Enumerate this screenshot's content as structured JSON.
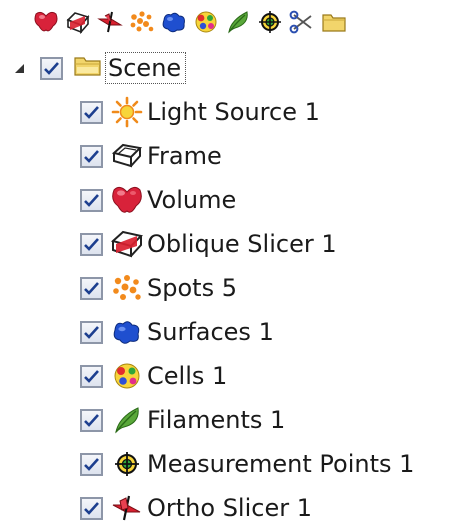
{
  "toolbar": {
    "buttons": [
      {
        "name": "volume",
        "icon": "volume-icon"
      },
      {
        "name": "oblique-slicer",
        "icon": "oblique-slicer-icon"
      },
      {
        "name": "ortho-slicer",
        "icon": "ortho-slicer-icon"
      },
      {
        "name": "spots",
        "icon": "spots-icon"
      },
      {
        "name": "surfaces",
        "icon": "surfaces-icon"
      },
      {
        "name": "cells",
        "icon": "cells-icon"
      },
      {
        "name": "filaments",
        "icon": "filaments-icon"
      },
      {
        "name": "measurement-points",
        "icon": "measurement-points-icon"
      },
      {
        "name": "clipping-plane",
        "icon": "scissors-icon"
      },
      {
        "name": "new-group",
        "icon": "folder-icon"
      }
    ]
  },
  "tree": {
    "root": {
      "label": "Scene",
      "checked": true,
      "expanded": true,
      "icon": "folder-icon"
    },
    "items": [
      {
        "label": "Light Source 1",
        "checked": true,
        "icon": "light-source-icon"
      },
      {
        "label": "Frame",
        "checked": true,
        "icon": "frame-icon"
      },
      {
        "label": "Volume",
        "checked": true,
        "icon": "volume-icon"
      },
      {
        "label": "Oblique Slicer 1",
        "checked": true,
        "icon": "oblique-slicer-icon"
      },
      {
        "label": "Spots 5",
        "checked": true,
        "icon": "spots-icon"
      },
      {
        "label": "Surfaces 1",
        "checked": true,
        "icon": "surfaces-icon"
      },
      {
        "label": "Cells 1",
        "checked": true,
        "icon": "cells-icon"
      },
      {
        "label": "Filaments 1",
        "checked": true,
        "icon": "filaments-icon"
      },
      {
        "label": "Measurement Points 1",
        "checked": true,
        "icon": "measurement-points-icon"
      },
      {
        "label": "Ortho Slicer 1",
        "checked": true,
        "icon": "ortho-slicer-icon"
      }
    ]
  },
  "colors": {
    "checkmark": "#1d3f8f",
    "checkbox_border": "#8d96a8",
    "text": "#1a1a1a",
    "folder": "#f2d56b"
  }
}
